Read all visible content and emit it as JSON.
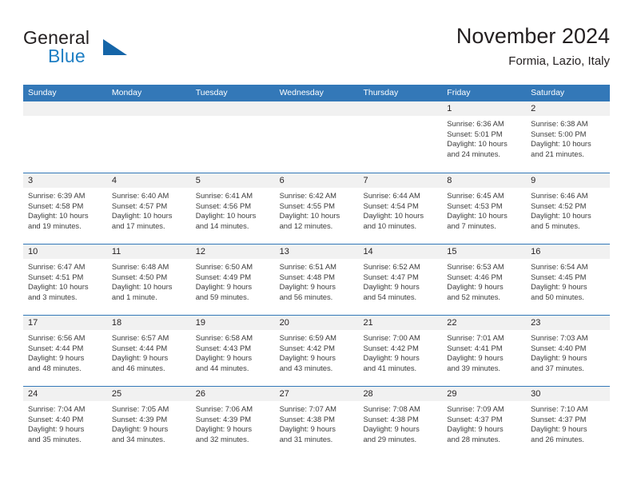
{
  "brand": {
    "name_part1": "General",
    "name_part2": "Blue",
    "logo_icon": "triangle-logo-icon",
    "accent_color": "#1f7fc4"
  },
  "header": {
    "title": "November 2024",
    "subtitle": "Formia, Lazio, Italy"
  },
  "theme": {
    "header_blue": "#3378b8",
    "daynum_band": "#f1f1f1",
    "text": "#231f20"
  },
  "weekdays": [
    "Sunday",
    "Monday",
    "Tuesday",
    "Wednesday",
    "Thursday",
    "Friday",
    "Saturday"
  ],
  "weeks": [
    [
      {
        "day": "",
        "sunrise": "",
        "sunset": "",
        "daylight_line1": "",
        "daylight_line2": ""
      },
      {
        "day": "",
        "sunrise": "",
        "sunset": "",
        "daylight_line1": "",
        "daylight_line2": ""
      },
      {
        "day": "",
        "sunrise": "",
        "sunset": "",
        "daylight_line1": "",
        "daylight_line2": ""
      },
      {
        "day": "",
        "sunrise": "",
        "sunset": "",
        "daylight_line1": "",
        "daylight_line2": ""
      },
      {
        "day": "",
        "sunrise": "",
        "sunset": "",
        "daylight_line1": "",
        "daylight_line2": ""
      },
      {
        "day": "1",
        "sunrise": "Sunrise: 6:36 AM",
        "sunset": "Sunset: 5:01 PM",
        "daylight_line1": "Daylight: 10 hours",
        "daylight_line2": "and 24 minutes."
      },
      {
        "day": "2",
        "sunrise": "Sunrise: 6:38 AM",
        "sunset": "Sunset: 5:00 PM",
        "daylight_line1": "Daylight: 10 hours",
        "daylight_line2": "and 21 minutes."
      }
    ],
    [
      {
        "day": "3",
        "sunrise": "Sunrise: 6:39 AM",
        "sunset": "Sunset: 4:58 PM",
        "daylight_line1": "Daylight: 10 hours",
        "daylight_line2": "and 19 minutes."
      },
      {
        "day": "4",
        "sunrise": "Sunrise: 6:40 AM",
        "sunset": "Sunset: 4:57 PM",
        "daylight_line1": "Daylight: 10 hours",
        "daylight_line2": "and 17 minutes."
      },
      {
        "day": "5",
        "sunrise": "Sunrise: 6:41 AM",
        "sunset": "Sunset: 4:56 PM",
        "daylight_line1": "Daylight: 10 hours",
        "daylight_line2": "and 14 minutes."
      },
      {
        "day": "6",
        "sunrise": "Sunrise: 6:42 AM",
        "sunset": "Sunset: 4:55 PM",
        "daylight_line1": "Daylight: 10 hours",
        "daylight_line2": "and 12 minutes."
      },
      {
        "day": "7",
        "sunrise": "Sunrise: 6:44 AM",
        "sunset": "Sunset: 4:54 PM",
        "daylight_line1": "Daylight: 10 hours",
        "daylight_line2": "and 10 minutes."
      },
      {
        "day": "8",
        "sunrise": "Sunrise: 6:45 AM",
        "sunset": "Sunset: 4:53 PM",
        "daylight_line1": "Daylight: 10 hours",
        "daylight_line2": "and 7 minutes."
      },
      {
        "day": "9",
        "sunrise": "Sunrise: 6:46 AM",
        "sunset": "Sunset: 4:52 PM",
        "daylight_line1": "Daylight: 10 hours",
        "daylight_line2": "and 5 minutes."
      }
    ],
    [
      {
        "day": "10",
        "sunrise": "Sunrise: 6:47 AM",
        "sunset": "Sunset: 4:51 PM",
        "daylight_line1": "Daylight: 10 hours",
        "daylight_line2": "and 3 minutes."
      },
      {
        "day": "11",
        "sunrise": "Sunrise: 6:48 AM",
        "sunset": "Sunset: 4:50 PM",
        "daylight_line1": "Daylight: 10 hours",
        "daylight_line2": "and 1 minute."
      },
      {
        "day": "12",
        "sunrise": "Sunrise: 6:50 AM",
        "sunset": "Sunset: 4:49 PM",
        "daylight_line1": "Daylight: 9 hours",
        "daylight_line2": "and 59 minutes."
      },
      {
        "day": "13",
        "sunrise": "Sunrise: 6:51 AM",
        "sunset": "Sunset: 4:48 PM",
        "daylight_line1": "Daylight: 9 hours",
        "daylight_line2": "and 56 minutes."
      },
      {
        "day": "14",
        "sunrise": "Sunrise: 6:52 AM",
        "sunset": "Sunset: 4:47 PM",
        "daylight_line1": "Daylight: 9 hours",
        "daylight_line2": "and 54 minutes."
      },
      {
        "day": "15",
        "sunrise": "Sunrise: 6:53 AM",
        "sunset": "Sunset: 4:46 PM",
        "daylight_line1": "Daylight: 9 hours",
        "daylight_line2": "and 52 minutes."
      },
      {
        "day": "16",
        "sunrise": "Sunrise: 6:54 AM",
        "sunset": "Sunset: 4:45 PM",
        "daylight_line1": "Daylight: 9 hours",
        "daylight_line2": "and 50 minutes."
      }
    ],
    [
      {
        "day": "17",
        "sunrise": "Sunrise: 6:56 AM",
        "sunset": "Sunset: 4:44 PM",
        "daylight_line1": "Daylight: 9 hours",
        "daylight_line2": "and 48 minutes."
      },
      {
        "day": "18",
        "sunrise": "Sunrise: 6:57 AM",
        "sunset": "Sunset: 4:44 PM",
        "daylight_line1": "Daylight: 9 hours",
        "daylight_line2": "and 46 minutes."
      },
      {
        "day": "19",
        "sunrise": "Sunrise: 6:58 AM",
        "sunset": "Sunset: 4:43 PM",
        "daylight_line1": "Daylight: 9 hours",
        "daylight_line2": "and 44 minutes."
      },
      {
        "day": "20",
        "sunrise": "Sunrise: 6:59 AM",
        "sunset": "Sunset: 4:42 PM",
        "daylight_line1": "Daylight: 9 hours",
        "daylight_line2": "and 43 minutes."
      },
      {
        "day": "21",
        "sunrise": "Sunrise: 7:00 AM",
        "sunset": "Sunset: 4:42 PM",
        "daylight_line1": "Daylight: 9 hours",
        "daylight_line2": "and 41 minutes."
      },
      {
        "day": "22",
        "sunrise": "Sunrise: 7:01 AM",
        "sunset": "Sunset: 4:41 PM",
        "daylight_line1": "Daylight: 9 hours",
        "daylight_line2": "and 39 minutes."
      },
      {
        "day": "23",
        "sunrise": "Sunrise: 7:03 AM",
        "sunset": "Sunset: 4:40 PM",
        "daylight_line1": "Daylight: 9 hours",
        "daylight_line2": "and 37 minutes."
      }
    ],
    [
      {
        "day": "24",
        "sunrise": "Sunrise: 7:04 AM",
        "sunset": "Sunset: 4:40 PM",
        "daylight_line1": "Daylight: 9 hours",
        "daylight_line2": "and 35 minutes."
      },
      {
        "day": "25",
        "sunrise": "Sunrise: 7:05 AM",
        "sunset": "Sunset: 4:39 PM",
        "daylight_line1": "Daylight: 9 hours",
        "daylight_line2": "and 34 minutes."
      },
      {
        "day": "26",
        "sunrise": "Sunrise: 7:06 AM",
        "sunset": "Sunset: 4:39 PM",
        "daylight_line1": "Daylight: 9 hours",
        "daylight_line2": "and 32 minutes."
      },
      {
        "day": "27",
        "sunrise": "Sunrise: 7:07 AM",
        "sunset": "Sunset: 4:38 PM",
        "daylight_line1": "Daylight: 9 hours",
        "daylight_line2": "and 31 minutes."
      },
      {
        "day": "28",
        "sunrise": "Sunrise: 7:08 AM",
        "sunset": "Sunset: 4:38 PM",
        "daylight_line1": "Daylight: 9 hours",
        "daylight_line2": "and 29 minutes."
      },
      {
        "day": "29",
        "sunrise": "Sunrise: 7:09 AM",
        "sunset": "Sunset: 4:37 PM",
        "daylight_line1": "Daylight: 9 hours",
        "daylight_line2": "and 28 minutes."
      },
      {
        "day": "30",
        "sunrise": "Sunrise: 7:10 AM",
        "sunset": "Sunset: 4:37 PM",
        "daylight_line1": "Daylight: 9 hours",
        "daylight_line2": "and 26 minutes."
      }
    ]
  ]
}
